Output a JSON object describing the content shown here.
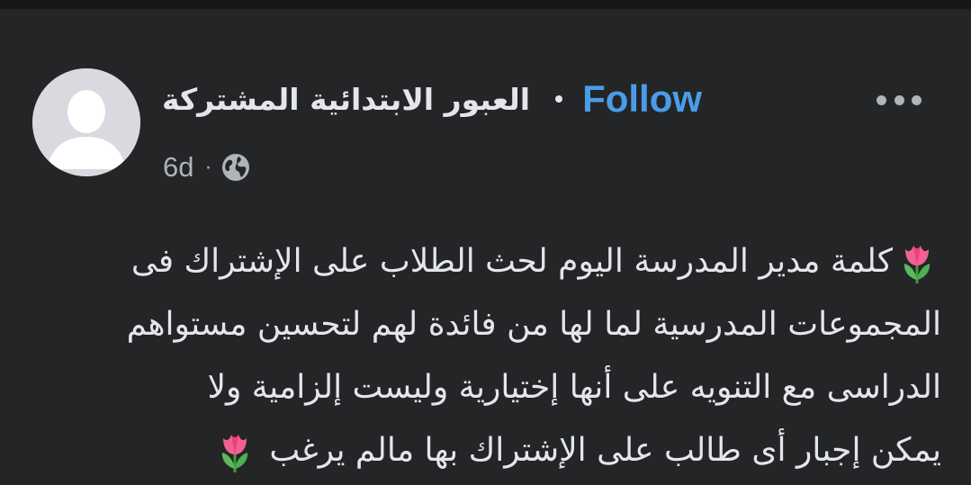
{
  "post": {
    "page_name": "العبور الابتدائية المشتركة",
    "follow_label": "Follow",
    "time_ago": "6d",
    "separator": "·",
    "audience_icon": "globe-icon",
    "more_icon": "more-options-icon",
    "avatar_icon": "default-profile-avatar",
    "emoji_icon": "tulip-emoji",
    "body_lines": [
      "كلمة مدير المدرسة اليوم لحث الطلاب على الإشتراك فى",
      "المجموعات المدرسية لما لها من فائدة لهم لتحسين مستواهم",
      "الدراسى مع التنويه على أنها إختيارية وليست إلزامية ولا",
      "يمكن إجبار أى طالب على الإشتراك بها مالم يرغب"
    ]
  },
  "colors": {
    "background": "#242526",
    "text_primary": "#e4e6eb",
    "text_secondary": "#b0b3b8",
    "link_blue": "#4b9ce8",
    "avatar_bg": "#d8dadf"
  }
}
